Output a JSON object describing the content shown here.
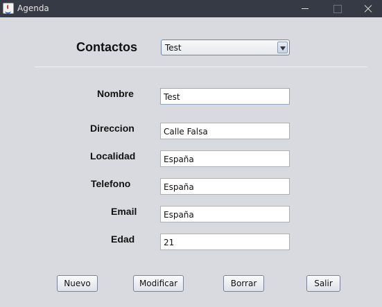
{
  "window": {
    "title": "Agenda"
  },
  "header": {
    "label": "Contactos",
    "combo": {
      "selected": "Test"
    }
  },
  "form": {
    "nombre": {
      "label": "Nombre",
      "value": "Test"
    },
    "direccion": {
      "label": "Direccion",
      "value": "Calle Falsa"
    },
    "localidad": {
      "label": "Localidad",
      "value": "España"
    },
    "telefono": {
      "label": "Telefono",
      "value": "España"
    },
    "email": {
      "label": "Email",
      "value": "España"
    },
    "edad": {
      "label": "Edad",
      "value": "21"
    }
  },
  "buttons": {
    "nuevo": "Nuevo",
    "modificar": "Modificar",
    "borrar": "Borrar",
    "salir": "Salir"
  },
  "icons": {
    "app": "java-cup-icon",
    "dropdown": "chevron-down-icon"
  },
  "colors": {
    "titlebar": "#363a44",
    "background": "#d8dae0"
  }
}
